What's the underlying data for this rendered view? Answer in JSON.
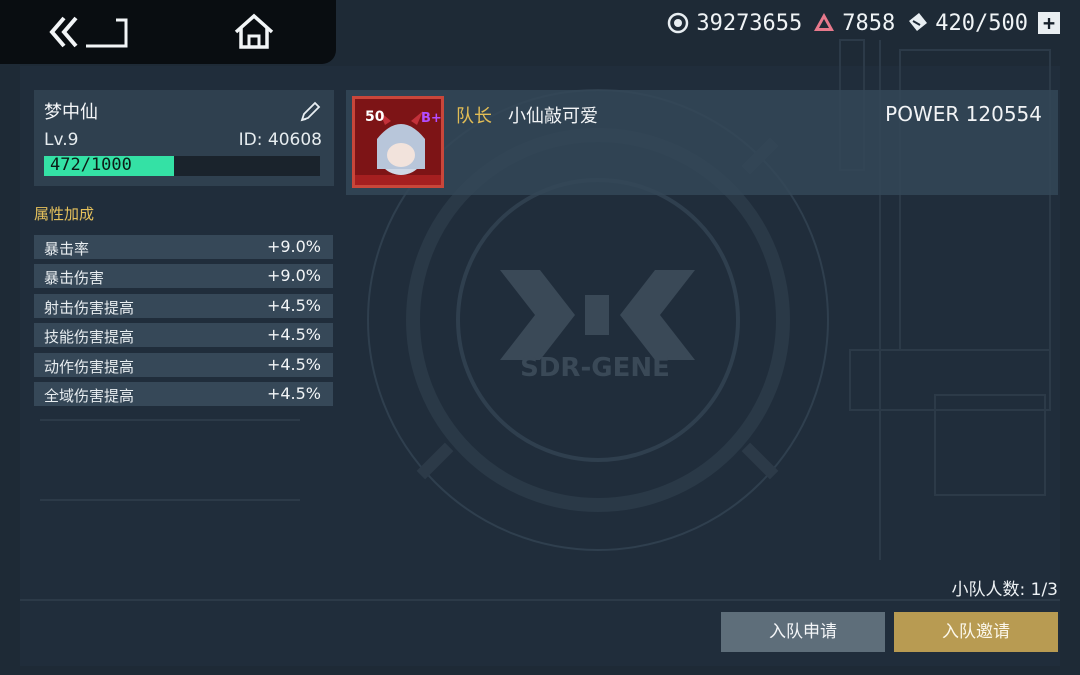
{
  "header": {
    "back_icon": "back-arrow-icon",
    "home_icon": "home-icon"
  },
  "currencies": [
    {
      "icon": "energy-core-icon",
      "value": "39273655"
    },
    {
      "icon": "gem-icon",
      "value": "7858"
    },
    {
      "icon": "ticket-icon",
      "value": "420/500"
    }
  ],
  "profile": {
    "name": "梦中仙",
    "level": "Lv.9",
    "id_label": "ID: 40608",
    "xp_text": "472/1000",
    "xp_fraction": 0.472
  },
  "attributes": {
    "title": "属性加成",
    "items": [
      {
        "label": "暴击率",
        "value": "+9.0%"
      },
      {
        "label": "暴击伤害",
        "value": "+9.0%"
      },
      {
        "label": "射击伤害提高",
        "value": "+4.5%"
      },
      {
        "label": "技能伤害提高",
        "value": "+4.5%"
      },
      {
        "label": "动作伤害提高",
        "value": "+4.5%"
      },
      {
        "label": "全域伤害提高",
        "value": "+4.5%"
      }
    ]
  },
  "member": {
    "avatar_level": "50",
    "avatar_grade": "B+",
    "role": "队长",
    "name": "小仙敲可爱",
    "power": "POWER 120554"
  },
  "watermark": "SDR-GENE",
  "team_count": "小队人数: 1/3",
  "buttons": {
    "apply": "入队申请",
    "invite": "入队邀请"
  },
  "colors": {
    "background": "#1e2a36",
    "xp_fill": "#34e1a5",
    "gold_accent": "#e2bd55",
    "invite_button": "#b89b52",
    "apply_button": "#5e6e7a"
  }
}
